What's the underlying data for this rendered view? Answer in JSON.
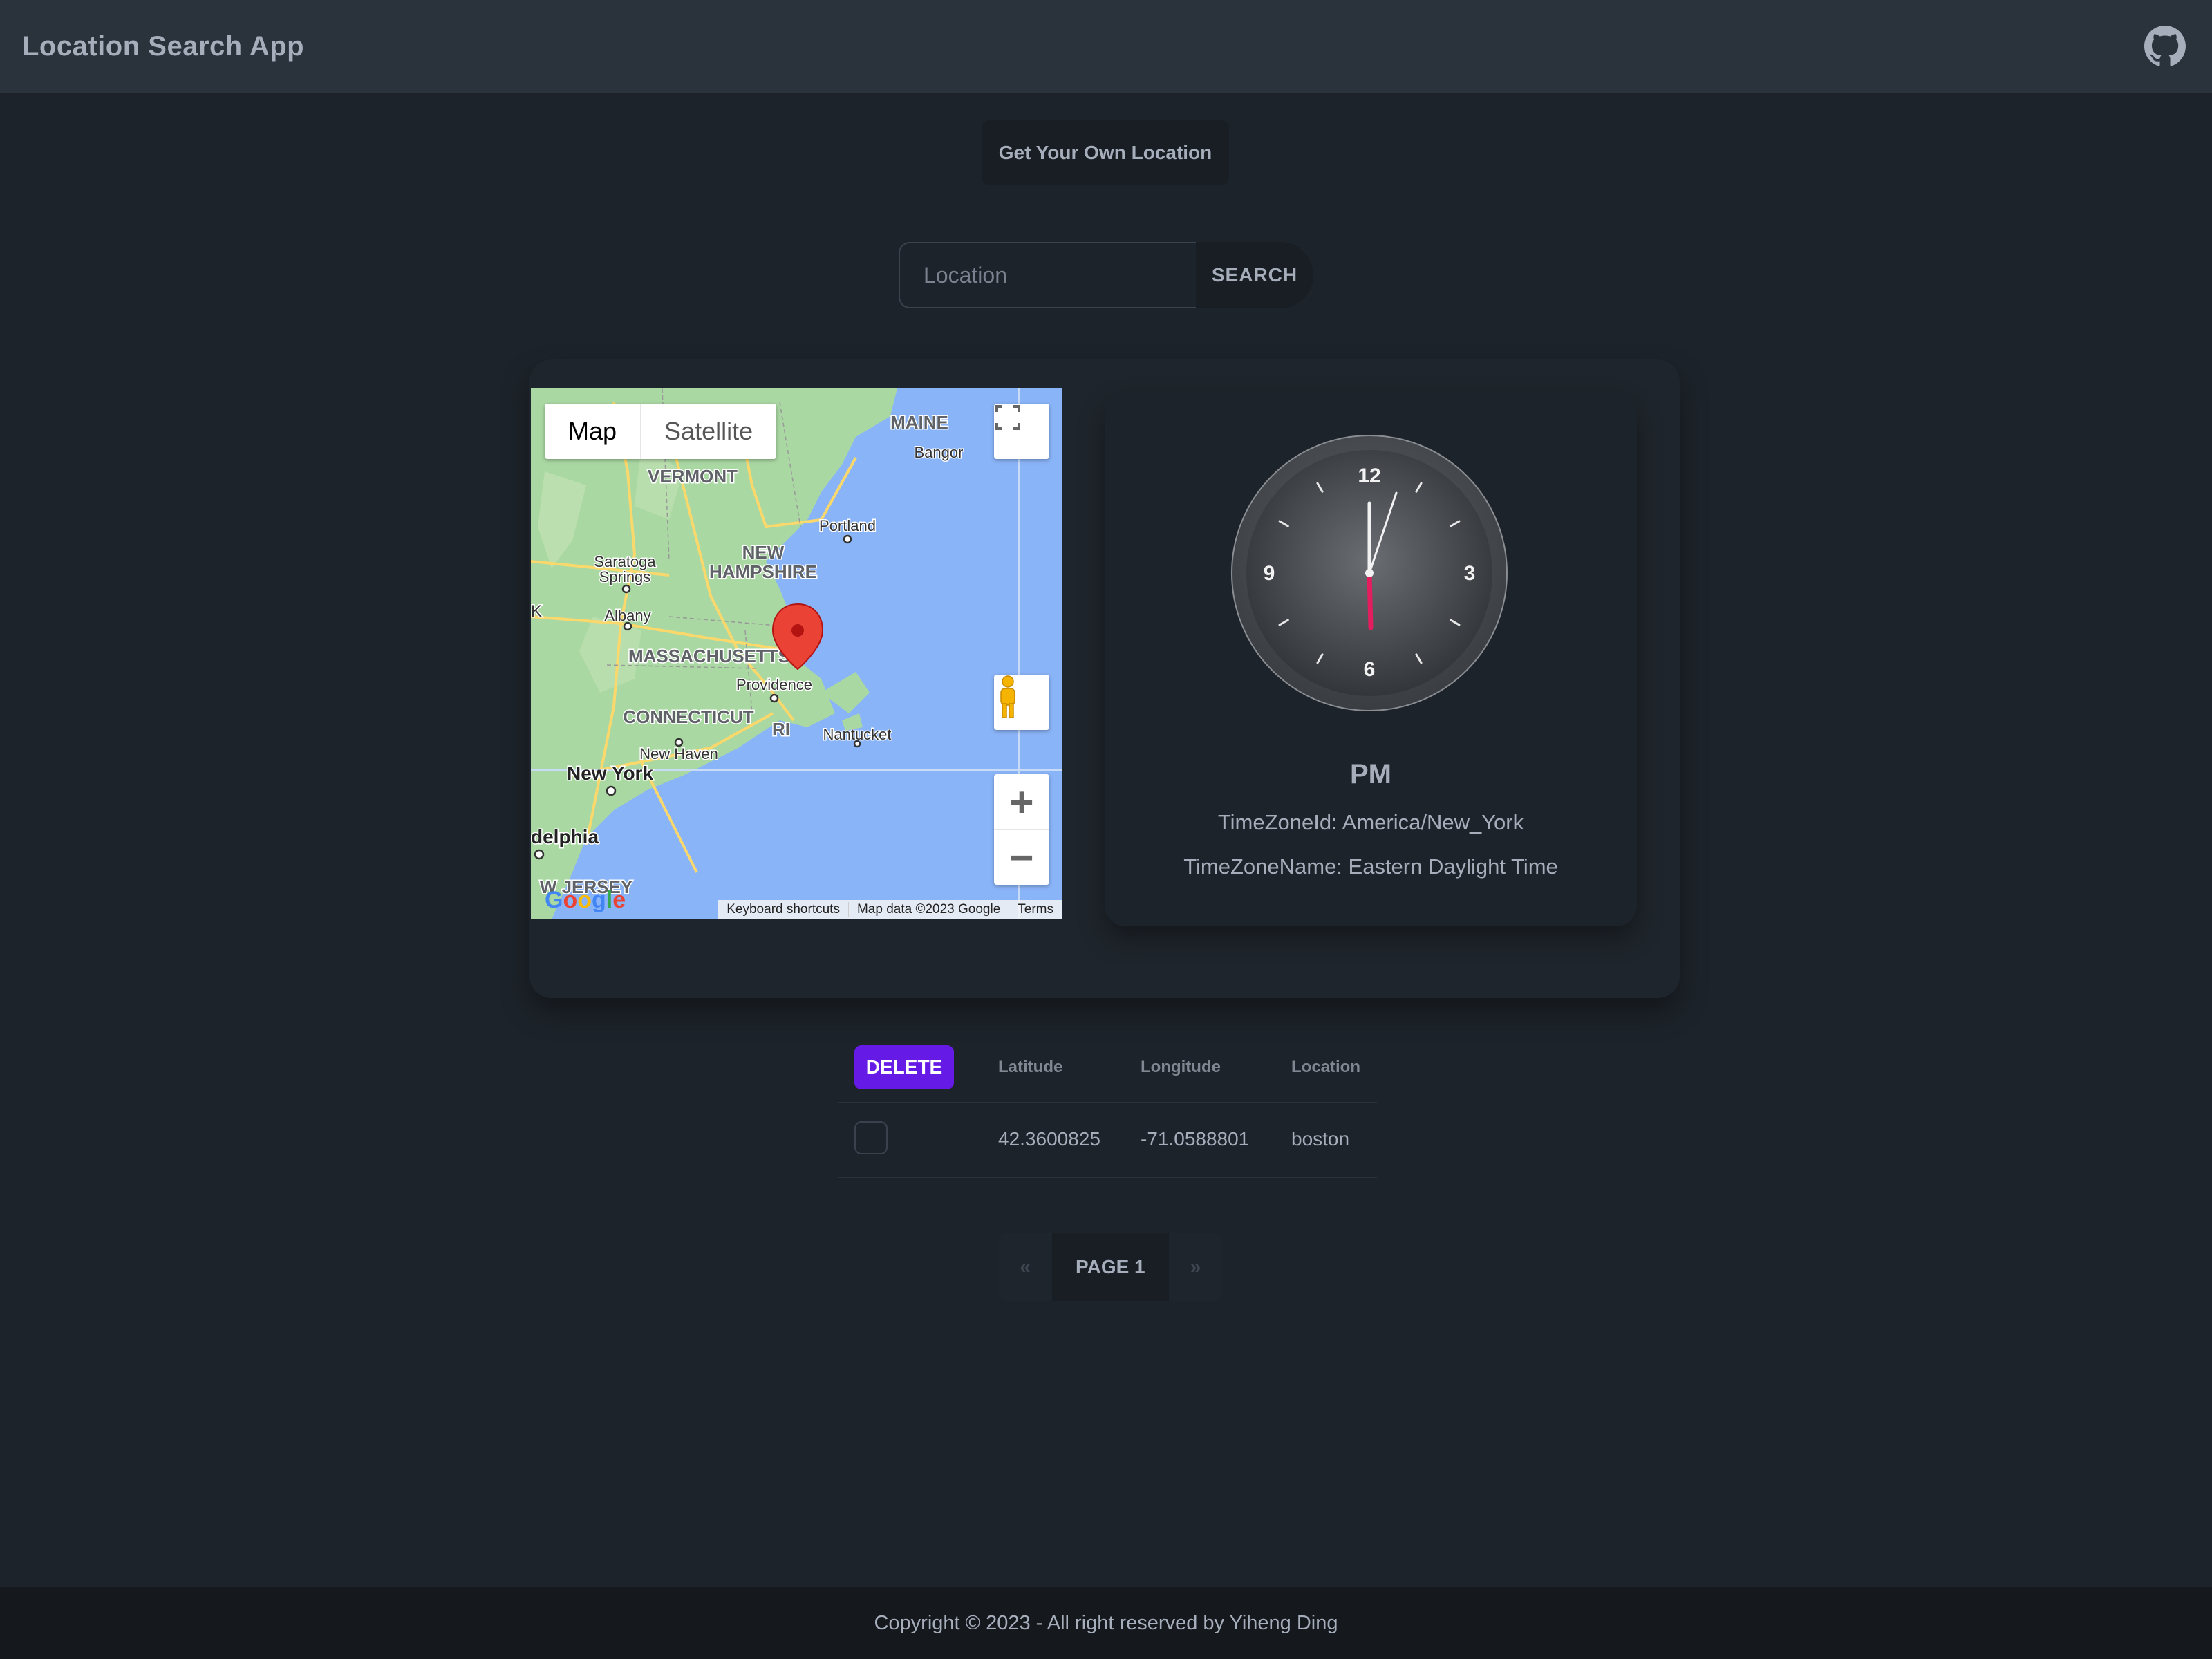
{
  "header": {
    "title": "Location Search App",
    "github_icon": "github-icon"
  },
  "actions": {
    "get_location_label": "Get Your Own Location"
  },
  "search": {
    "placeholder": "Location",
    "value": "",
    "button_label": "SEARCH"
  },
  "map": {
    "type_controls": [
      "Map",
      "Satellite"
    ],
    "active_type": "Map",
    "labels": {
      "maine": "MAINE",
      "bangor": "Bangor",
      "vermont": "VERMONT",
      "portland": "Portland",
      "new": "NEW",
      "hampshire": "HAMPSHIRE",
      "saratoga": "Saratoga",
      "springs": "Springs",
      "albany": "Albany",
      "massachusetts": "MASSACHUSETTS",
      "providence": "Providence",
      "connecticut": "CONNECTICUT",
      "ri": "RI",
      "nantucket": "Nantucket",
      "new_haven": "New Haven",
      "new_york": "New York",
      "philadelphia": "delphia",
      "new_jersey": "W JERSEY",
      "k": "K"
    },
    "footer": [
      "Keyboard shortcuts",
      "Map data ©2023 Google",
      "Terms"
    ],
    "logo": "Google",
    "zoom_in": "+",
    "zoom_out": "−",
    "colors": {
      "water": "#8ab4f8",
      "land": "#aad8a3",
      "road": "#fbd86b",
      "pin": "#ea4335"
    }
  },
  "clock": {
    "numbers": [
      "12",
      "3",
      "6",
      "9"
    ],
    "period": "PM",
    "time_zone_id": "TimeZoneId: America/New_York",
    "time_zone_name": "TimeZoneName: Eastern Daylight Time",
    "second_hand_color": "#e31d5e"
  },
  "table": {
    "delete_label": "DELETE",
    "columns": [
      "Latitude",
      "Longitude",
      "Location"
    ],
    "rows": [
      {
        "latitude": "42.3600825",
        "longitude": "-71.0588801",
        "location": "boston",
        "checked": false
      }
    ]
  },
  "pagination": {
    "prev": "«",
    "current": "PAGE 1",
    "next": "»"
  },
  "footer": {
    "text": "Copyright © 2023 - All right reserved by Yiheng Ding"
  },
  "colors": {
    "accent": "#661ae6",
    "background": "#1d232a",
    "navbar": "#2a323c"
  }
}
